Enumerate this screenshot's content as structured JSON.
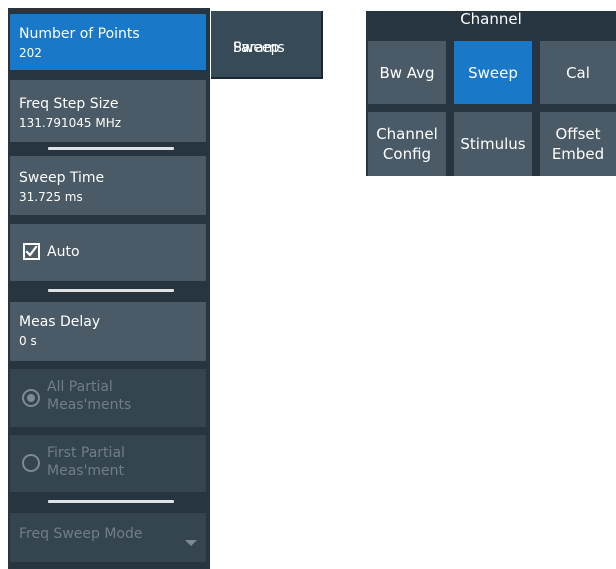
{
  "sweep_panel": {
    "number_of_points": {
      "label": "Number of Points",
      "value": "202"
    },
    "freq_step_size": {
      "label": "Freq Step Size",
      "value": "131.791045 MHz"
    },
    "sweep_time": {
      "label": "Sweep Time",
      "value": "31.725 ms"
    },
    "auto": {
      "label": "Auto",
      "checked": true
    },
    "meas_delay": {
      "label": "Meas Delay",
      "value": "0 s"
    },
    "all_partial": {
      "line1": "All Partial",
      "line2": "Meas'ments",
      "selected": true,
      "enabled": false
    },
    "first_partial": {
      "line1": "First Partial",
      "line2": "Meas'ment",
      "selected": false,
      "enabled": false
    },
    "freq_sweep_mode": {
      "label": "Freq Sweep Mode",
      "enabled": false
    }
  },
  "tab": {
    "line1": "Sweep",
    "line2": "Params"
  },
  "channel_menu": {
    "title": "Channel",
    "buttons": [
      {
        "label": "Bw Avg"
      },
      {
        "label": "Sweep",
        "active": true
      },
      {
        "label": "Cal"
      },
      {
        "line1": "Channel",
        "line2": "Config"
      },
      {
        "label": "Stimulus"
      },
      {
        "line1": "Offset",
        "line2": "Embed"
      }
    ]
  },
  "colors": {
    "panel_bg": "#263540",
    "button_bg": "#4a5a66",
    "active_blue": "#1a78c8",
    "disabled_text": "#6f7e89"
  },
  "icons": [
    "checkbox-checked-icon",
    "radio-selected-icon",
    "radio-unselected-icon",
    "dropdown-arrow-icon"
  ]
}
